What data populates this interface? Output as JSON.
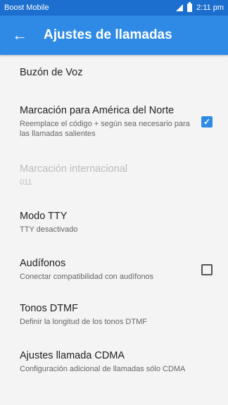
{
  "status_bar": {
    "carrier": "Boost Mobile",
    "time": "2:11 pm"
  },
  "app_bar": {
    "title": "Ajustes de llamadas",
    "back_icon": "←"
  },
  "items": [
    {
      "title": "Buzón de Voz"
    },
    {
      "title": "Marcación para América del Norte",
      "subtitle": "Reemplace el código + según sea necesario para las llamadas salientes",
      "checked": true,
      "check_glyph": "✓"
    },
    {
      "title": "Marcación internacional",
      "subtitle": "011",
      "disabled": true
    },
    {
      "title": "Modo TTY",
      "subtitle": "TTY desactivado"
    },
    {
      "title": "Audífonos",
      "subtitle": "Conectar compatibilidad con audífonos",
      "checked": false
    },
    {
      "title": "Tonos DTMF",
      "subtitle": "Definir la longitud de los tonos DTMF"
    },
    {
      "title": "Ajustes llamada CDMA",
      "subtitle": "Configuración adicional de llamadas sólo CDMA"
    }
  ],
  "colors": {
    "status_bar": "#1c6fcf",
    "app_bar": "#2f8ae5",
    "accent": "#2f8ae5",
    "background": "#f4f4f4"
  }
}
